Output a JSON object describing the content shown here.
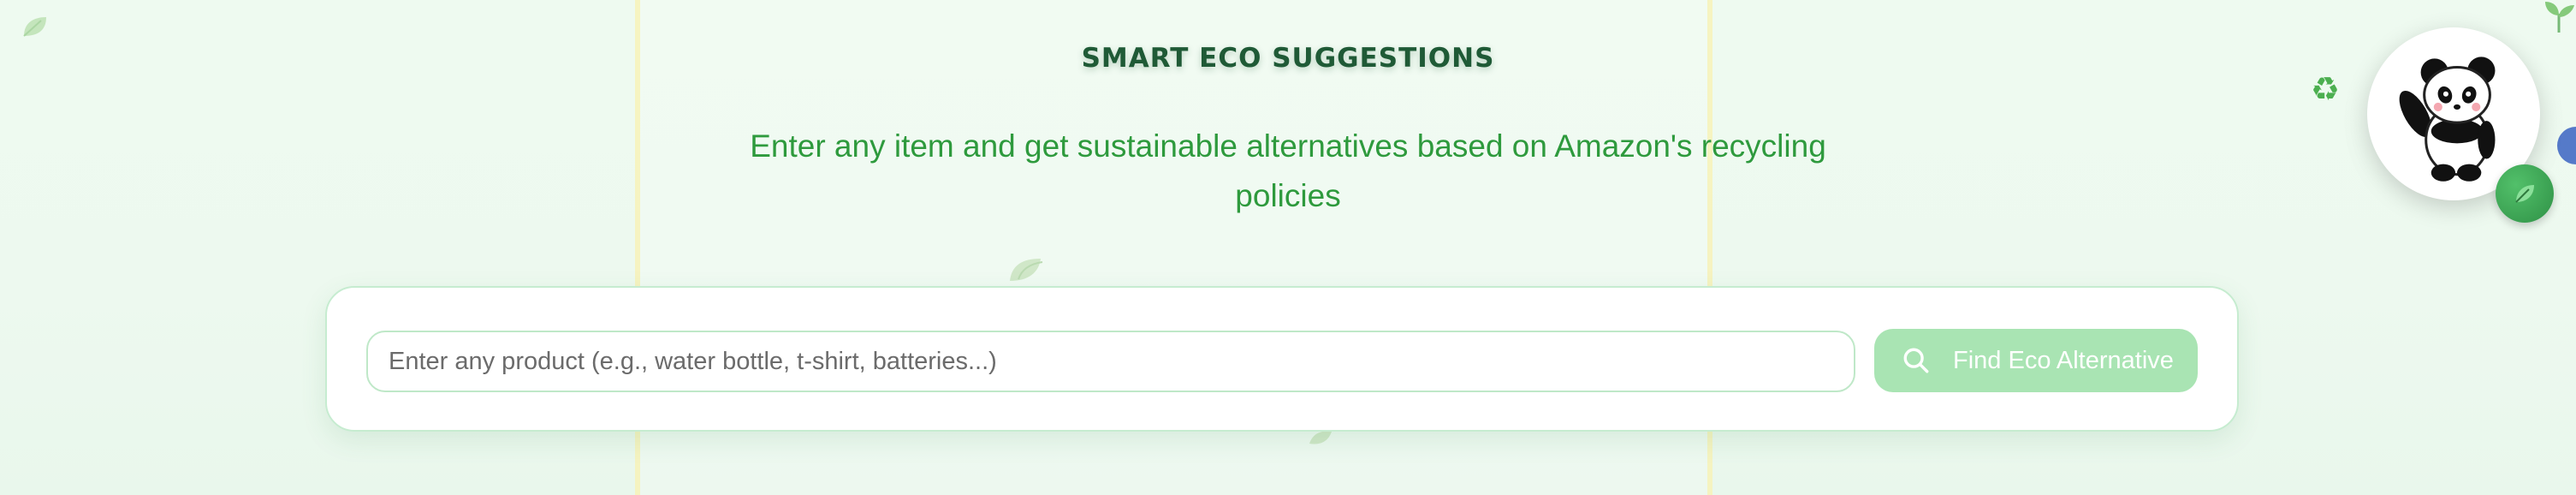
{
  "header": {
    "title": "SMART ECO SUGGESTIONS",
    "subtitle": "Enter any item and get sustainable alternatives based on Amazon's recycling policies"
  },
  "search": {
    "placeholder": "Enter any product (e.g., water bottle, t-shirt, batteries...)",
    "value": "",
    "button_label": "Find Eco Alternative"
  },
  "icons": {
    "search": "search-icon",
    "panda": "panda-icon",
    "leaf": "leaf-icon",
    "recycle": "recycle-icon",
    "globe": "globe-icon"
  },
  "colors": {
    "background": "#ecf8ee",
    "title": "#1f5a36",
    "subtitle": "#2e9a3d",
    "button": "#a9e4b3",
    "accent_line": "#f7f2b8"
  }
}
